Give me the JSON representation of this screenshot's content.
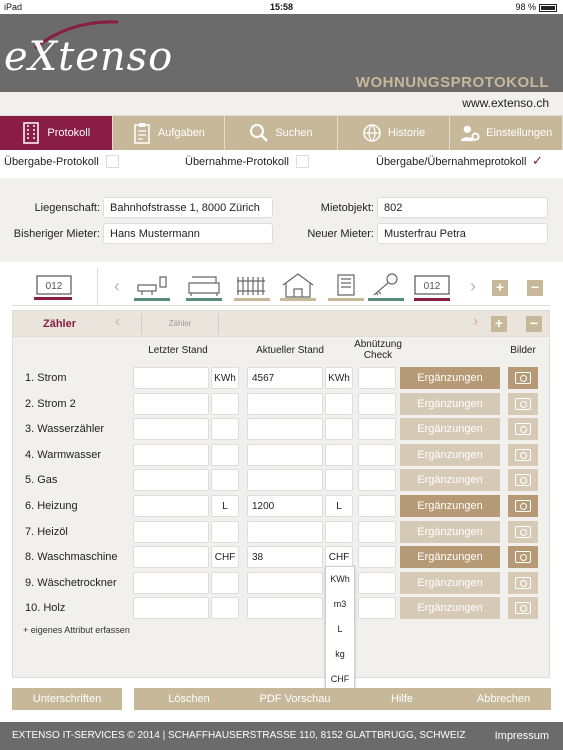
{
  "status_bar": {
    "device": "iPad",
    "time": "15:58",
    "battery": "98 %"
  },
  "header": {
    "logo_text": "eXtenso",
    "app_title": "WOHNUNGSPROTOKOLL",
    "url": "www.extenso.ch"
  },
  "tabs": [
    {
      "label": "Protokoll",
      "icon": "building-icon",
      "active": true
    },
    {
      "label": "Aufgaben",
      "icon": "clipboard-icon",
      "active": false
    },
    {
      "label": "Suchen",
      "icon": "search-icon",
      "active": false
    },
    {
      "label": "Historie",
      "icon": "globe-icon",
      "active": false
    },
    {
      "label": "Einstellungen",
      "icon": "users-gear-icon",
      "active": false
    }
  ],
  "protocol_types": [
    {
      "label": "Übergabe-Protokoll",
      "checked": false
    },
    {
      "label": "Übernahme-Protokoll",
      "checked": false
    },
    {
      "label": "Übergabe/Übernahmeprotokoll",
      "checked": true
    }
  ],
  "fields": {
    "liegenschaft": {
      "label": "Liegenschaft:",
      "value": "Bahnhofstrasse 1, 8000 Zürich"
    },
    "mietobjekt": {
      "label": "Mietobjekt:",
      "value": "802"
    },
    "bisheriger_mieter": {
      "label": "Bisheriger Mieter:",
      "value": "Hans Mustermann"
    },
    "neuer_mieter": {
      "label": "Neuer Mieter:",
      "value": "Musterfrau Petra"
    }
  },
  "category_bar": {
    "selected_icon": "meter-icon",
    "categories": [
      "bathroom-icon",
      "sofa-icon",
      "radiator-icon",
      "house-icon",
      "documents-icon",
      "keys-icon",
      "meter-icon"
    ]
  },
  "panel": {
    "title": "Zähler",
    "subtab": "Zähler",
    "columns": {
      "letzter_stand": "Letzter Stand",
      "aktueller_stand": "Aktueller Stand",
      "abnuetzung": "Abnützung",
      "check": "Check",
      "bilder": "Bilder"
    },
    "rows": [
      {
        "label": "1. Strom",
        "last": "",
        "last_unit": "KWh",
        "current": "4567",
        "current_unit": "KWh",
        "active": true
      },
      {
        "label": "2. Strom 2",
        "last": "",
        "last_unit": "",
        "current": "",
        "current_unit": "",
        "active": false
      },
      {
        "label": "3. Wasserzähler",
        "last": "",
        "last_unit": "",
        "current": "",
        "current_unit": "",
        "active": false
      },
      {
        "label": "4. Warmwasser",
        "last": "",
        "last_unit": "",
        "current": "",
        "current_unit": "",
        "active": false
      },
      {
        "label": "5. Gas",
        "last": "",
        "last_unit": "",
        "current": "",
        "current_unit": "",
        "active": false
      },
      {
        "label": "6. Heizung",
        "last": "",
        "last_unit": "L",
        "current": "1200",
        "current_unit": "L",
        "active": true
      },
      {
        "label": "7. Heizöl",
        "last": "",
        "last_unit": "",
        "current": "",
        "current_unit": "",
        "active": false
      },
      {
        "label": "8. Waschmaschine",
        "last": "",
        "last_unit": "CHF",
        "current": "38",
        "current_unit": "CHF",
        "active": true
      },
      {
        "label": "9. Wäschetrockner",
        "last": "",
        "last_unit": "",
        "current": "",
        "current_unit": "",
        "active": false
      },
      {
        "label": "10. Holz",
        "last": "",
        "last_unit": "",
        "current": "",
        "current_unit": "",
        "active": false
      }
    ],
    "ergaenzungen_label": "Ergänzungen",
    "add_attribute": "+ eigenes Attribut erfassen"
  },
  "unit_dropdown": [
    "KWh",
    "m3",
    "L",
    "kg",
    "CHF"
  ],
  "footer_buttons": [
    "Unterschriften",
    "Löschen",
    "PDF Vorschau",
    "Hilfe",
    "Abbrechen"
  ],
  "footer": {
    "copyright": "EXTENSO IT-SERVICES © 2014 | SCHAFFHAUSERSTRASSE 110, 8152 GLATTBRUGG, SCHWEIZ",
    "impressum": "Impressum"
  },
  "colors": {
    "accent": "#8a1d43",
    "tan": "#c8b89a",
    "header_gray": "#6b6b6b"
  }
}
